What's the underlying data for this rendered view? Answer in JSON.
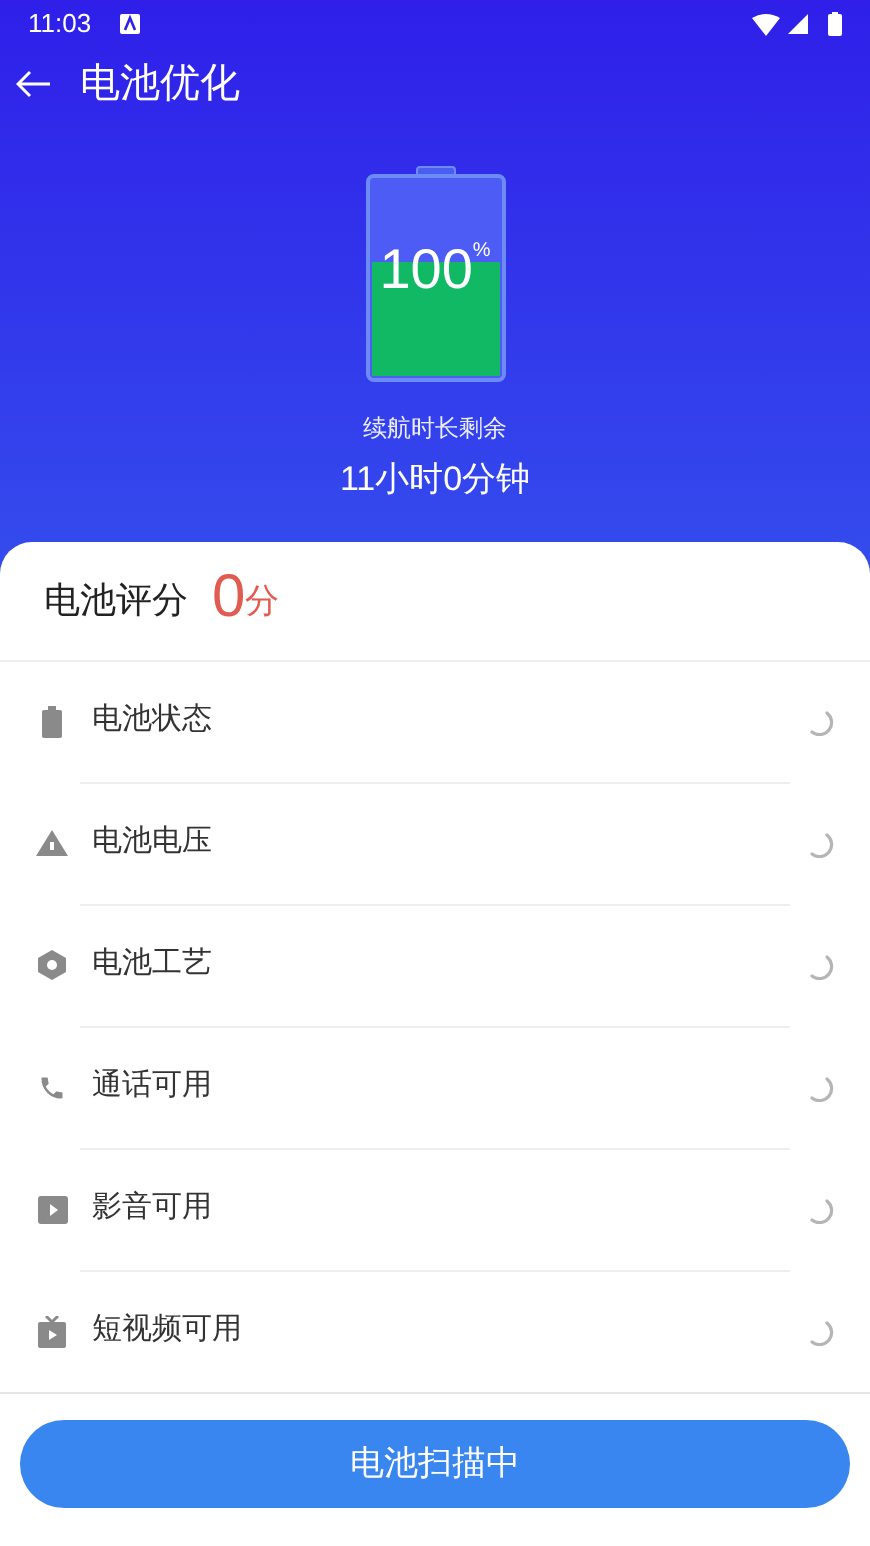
{
  "status_bar": {
    "time": "11:03"
  },
  "header": {
    "title": "电池优化"
  },
  "battery": {
    "percent": "100",
    "unit": "%",
    "caption": "续航时长剩余",
    "remaining": "11小时0分钟"
  },
  "score": {
    "label": "电池评分",
    "value": "0",
    "unit": "分"
  },
  "checks": [
    {
      "kind": "battery",
      "label": "电池状态"
    },
    {
      "kind": "voltage",
      "label": "电池电压"
    },
    {
      "kind": "craft",
      "label": "电池工艺"
    },
    {
      "kind": "call",
      "label": "通话可用"
    },
    {
      "kind": "media",
      "label": "影音可用"
    },
    {
      "kind": "video",
      "label": "短视频可用"
    }
  ],
  "button": {
    "label": "电池扫描中"
  }
}
